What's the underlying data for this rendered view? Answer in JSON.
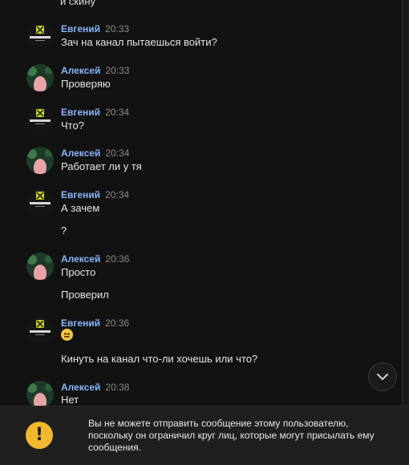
{
  "top_cut_text": "и скину",
  "messages": [
    {
      "author": "Евгений",
      "time": "20:33",
      "lines": [
        "Зач на канал пытаешься войти?"
      ]
    },
    {
      "author": "Алексей",
      "time": "20:33",
      "lines": [
        "Проверяю"
      ]
    },
    {
      "author": "Евгений",
      "time": "20:34",
      "lines": [
        "Что?"
      ]
    },
    {
      "author": "Алексей",
      "time": "20:34",
      "lines": [
        "Работает ли у тя"
      ]
    },
    {
      "author": "Евгений",
      "time": "20:34",
      "lines": [
        "А зачем",
        "?"
      ]
    },
    {
      "author": "Алексей",
      "time": "20:36",
      "lines": [
        "Просто",
        "Проверил"
      ]
    },
    {
      "author": "Евгений",
      "time": "20:36",
      "lines": [
        "😶",
        "Кинуть на канал что-ли хочешь или что?"
      ]
    },
    {
      "author": "Алексей",
      "time": "20:38",
      "lines": [
        "Нет"
      ]
    }
  ],
  "avatar_logo_text": "EVEGENIY",
  "scroll_button_icon": "chevron-down-icon",
  "notice": {
    "icon": "warning-icon",
    "text": "Вы не можете отправить сообщение этому пользователю, поскольку он ограничил круг лиц, которые могут присылать ему сообщения."
  },
  "colors": {
    "author": "#8ab4ff",
    "warning": "#f0b72f",
    "background": "#121212"
  }
}
